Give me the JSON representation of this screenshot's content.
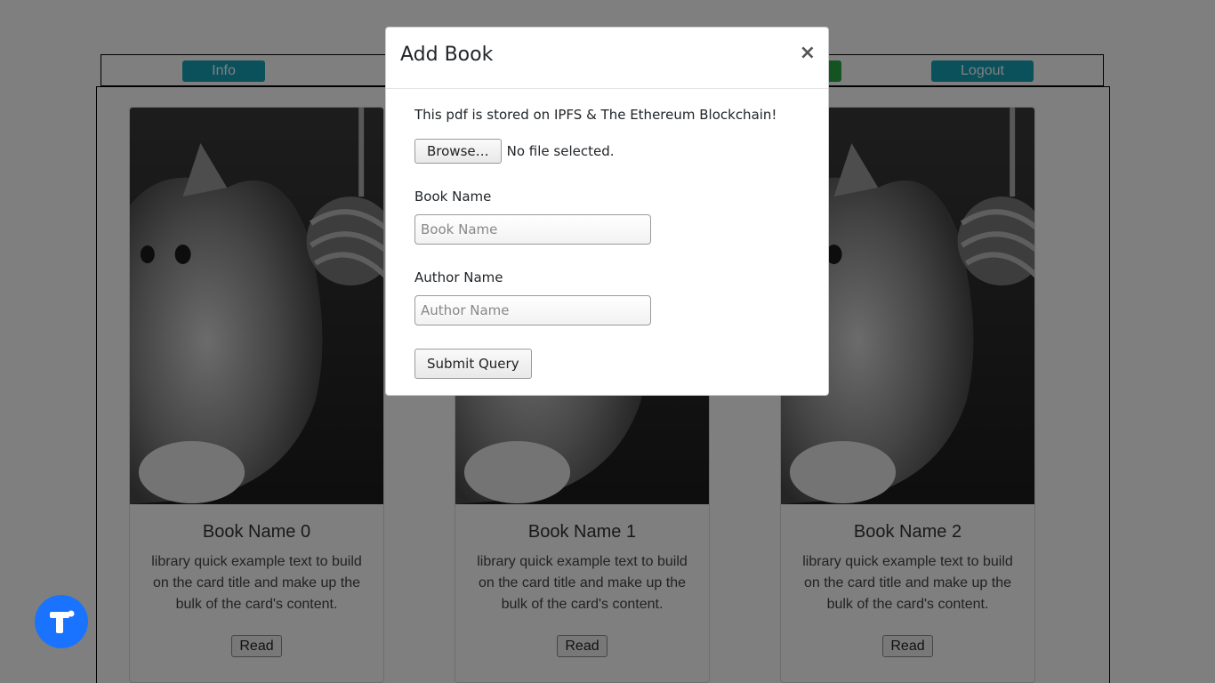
{
  "navbar": {
    "info_label": "Info",
    "logout_label": "Logout",
    "hidden_button_color": "#28a745",
    "accent_color": "#17a2b8"
  },
  "cards": [
    {
      "title": "Book Name 0",
      "text": "library quick example text to build on the card title and make up the bulk of the card's content.",
      "button_label": "Read",
      "image_icon": "kitten-photo"
    },
    {
      "title": "Book Name 1",
      "text": "library quick example text to build on the card title and make up the bulk of the card's content.",
      "button_label": "Read",
      "image_icon": "kitten-photo"
    },
    {
      "title": "Book Name 2",
      "text": "library quick example text to build on the card title and make up the bulk of the card's content.",
      "button_label": "Read",
      "image_icon": "kitten-photo"
    }
  ],
  "modal": {
    "title": "Add Book",
    "close_symbol": "×",
    "info_text": "This pdf is stored on IPFS & The Ethereum Blockchain!",
    "browse_label": "Browse…",
    "file_status": "No file selected.",
    "book_name_label": "Book Name",
    "book_name_placeholder": "Book Name",
    "book_name_value": "",
    "author_name_label": "Author Name",
    "author_name_placeholder": "Author Name",
    "author_name_value": "",
    "submit_label": "Submit Query"
  },
  "floating_widget": {
    "icon": "t-logo-icon",
    "color": "#1a73ff"
  }
}
